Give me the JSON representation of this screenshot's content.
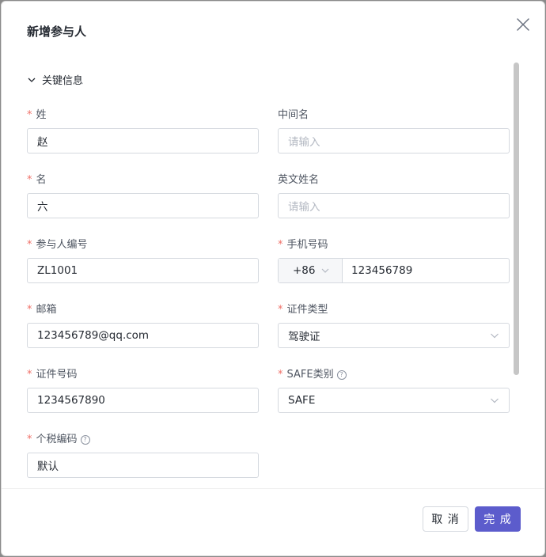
{
  "dialog": {
    "title": "新增参与人",
    "section_title": "关键信息",
    "fields": {
      "last_name": {
        "label": "姓",
        "value": "赵"
      },
      "middle_name": {
        "label": "中间名",
        "placeholder": "请输入"
      },
      "first_name": {
        "label": "名",
        "value": "六"
      },
      "english_name": {
        "label": "英文姓名",
        "placeholder": "请输入"
      },
      "participant_id": {
        "label": "参与人编号",
        "value": "ZL1001"
      },
      "phone": {
        "label": "手机号码",
        "country_code": "+86",
        "value": "123456789"
      },
      "email": {
        "label": "邮箱",
        "value": "123456789@qq.com"
      },
      "id_type": {
        "label": "证件类型",
        "value": "驾驶证"
      },
      "id_number": {
        "label": "证件号码",
        "value": "1234567890"
      },
      "safe_type": {
        "label": "SAFE类别",
        "value": "SAFE"
      },
      "tax_code": {
        "label": "个税编码",
        "value": "默认"
      }
    },
    "required_mark": "*",
    "help_mark": "?",
    "buttons": {
      "cancel": "取 消",
      "ok": "完 成"
    }
  }
}
